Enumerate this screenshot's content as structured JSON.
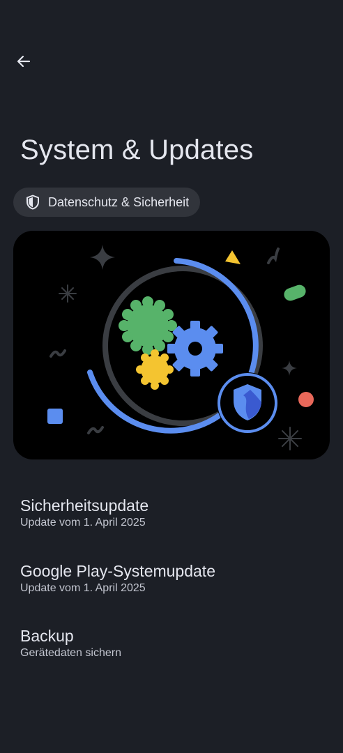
{
  "header": {
    "back_icon": "arrow-back-icon"
  },
  "page": {
    "title": "System & Updates"
  },
  "chip": {
    "icon": "shield-icon",
    "label": "Datenschutz & Sicherheit"
  },
  "hero": {
    "illustration": "system-updates-illustration",
    "colors": {
      "blue": "#5b8def",
      "green": "#57b36a",
      "yellow": "#f4c430",
      "red": "#e8685a",
      "gray": "#3a3d42"
    }
  },
  "list": {
    "items": [
      {
        "title": "Sicherheitsupdate",
        "subtitle": "Update vom 1. April 2025"
      },
      {
        "title": "Google Play-Systemupdate",
        "subtitle": "Update vom 1. April 2025"
      },
      {
        "title": "Backup",
        "subtitle": "Gerätedaten sichern"
      }
    ]
  }
}
